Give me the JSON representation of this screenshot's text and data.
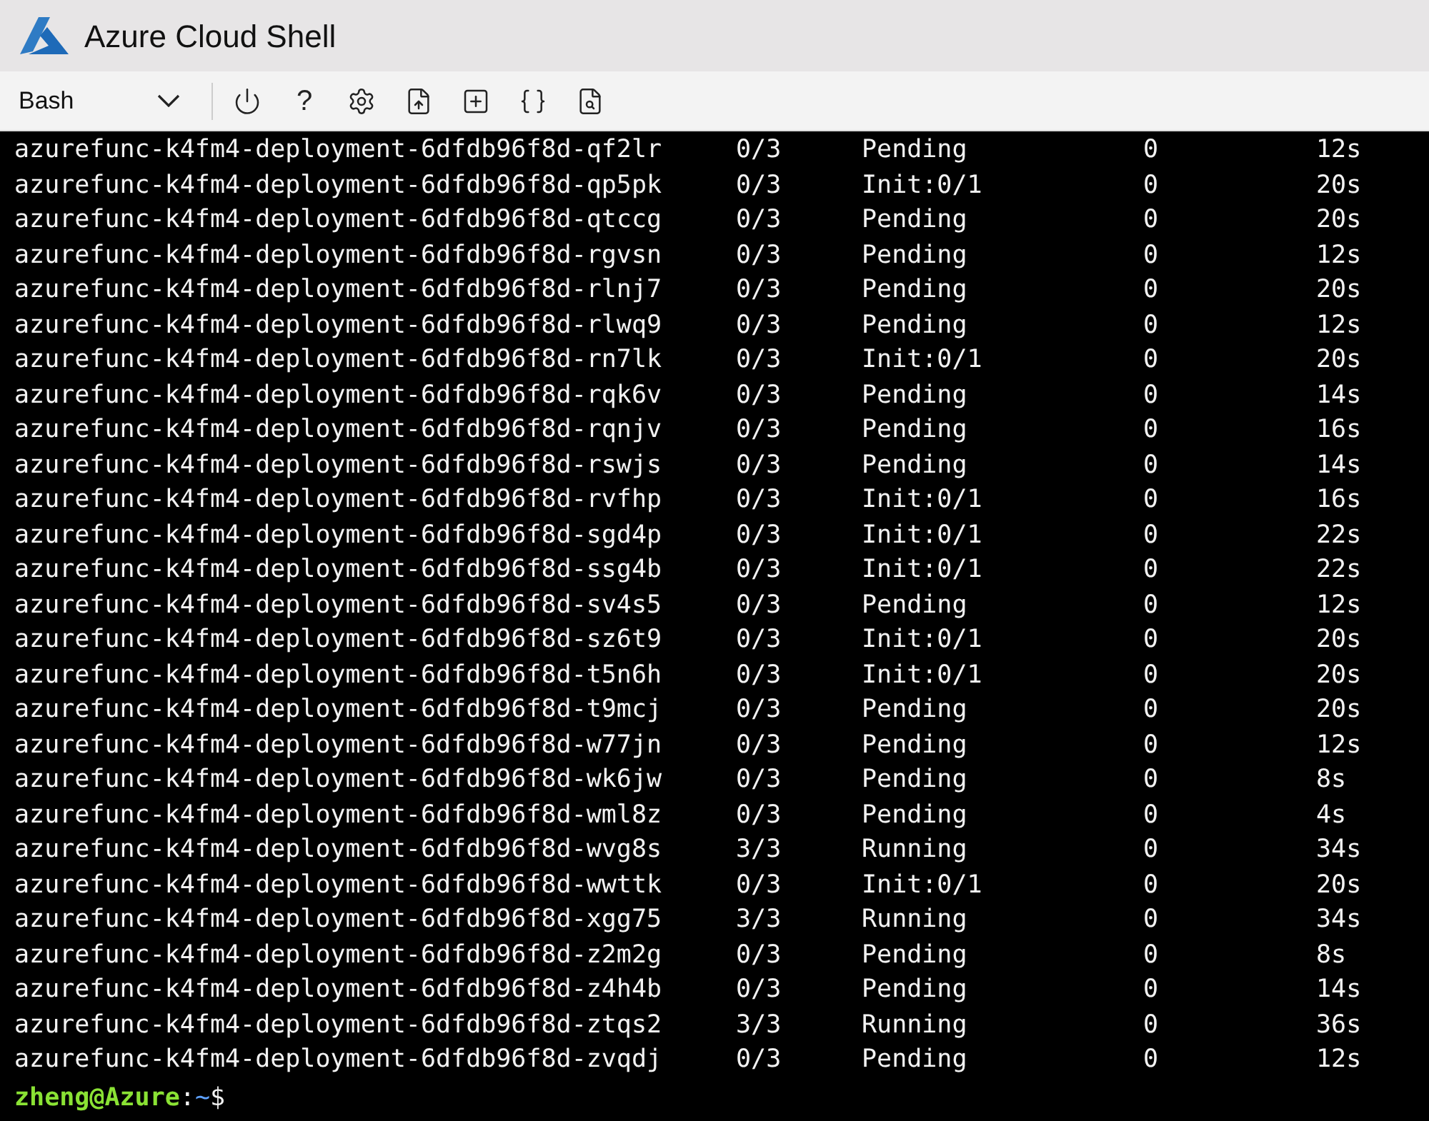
{
  "window": {
    "title": "Azure Cloud Shell"
  },
  "toolbar": {
    "shell": "Bash",
    "help": "?"
  },
  "terminal": {
    "rows": [
      {
        "name": "azurefunc-k4fm4-deployment-6dfdb96f8d-qf2lr",
        "ready": "0/3",
        "status": "Pending",
        "restarts": "0",
        "age": "12s"
      },
      {
        "name": "azurefunc-k4fm4-deployment-6dfdb96f8d-qp5pk",
        "ready": "0/3",
        "status": "Init:0/1",
        "restarts": "0",
        "age": "20s"
      },
      {
        "name": "azurefunc-k4fm4-deployment-6dfdb96f8d-qtccg",
        "ready": "0/3",
        "status": "Pending",
        "restarts": "0",
        "age": "20s"
      },
      {
        "name": "azurefunc-k4fm4-deployment-6dfdb96f8d-rgvsn",
        "ready": "0/3",
        "status": "Pending",
        "restarts": "0",
        "age": "12s"
      },
      {
        "name": "azurefunc-k4fm4-deployment-6dfdb96f8d-rlnj7",
        "ready": "0/3",
        "status": "Pending",
        "restarts": "0",
        "age": "20s"
      },
      {
        "name": "azurefunc-k4fm4-deployment-6dfdb96f8d-rlwq9",
        "ready": "0/3",
        "status": "Pending",
        "restarts": "0",
        "age": "12s"
      },
      {
        "name": "azurefunc-k4fm4-deployment-6dfdb96f8d-rn7lk",
        "ready": "0/3",
        "status": "Init:0/1",
        "restarts": "0",
        "age": "20s"
      },
      {
        "name": "azurefunc-k4fm4-deployment-6dfdb96f8d-rqk6v",
        "ready": "0/3",
        "status": "Pending",
        "restarts": "0",
        "age": "14s"
      },
      {
        "name": "azurefunc-k4fm4-deployment-6dfdb96f8d-rqnjv",
        "ready": "0/3",
        "status": "Pending",
        "restarts": "0",
        "age": "16s"
      },
      {
        "name": "azurefunc-k4fm4-deployment-6dfdb96f8d-rswjs",
        "ready": "0/3",
        "status": "Pending",
        "restarts": "0",
        "age": "14s"
      },
      {
        "name": "azurefunc-k4fm4-deployment-6dfdb96f8d-rvfhp",
        "ready": "0/3",
        "status": "Init:0/1",
        "restarts": "0",
        "age": "16s"
      },
      {
        "name": "azurefunc-k4fm4-deployment-6dfdb96f8d-sgd4p",
        "ready": "0/3",
        "status": "Init:0/1",
        "restarts": "0",
        "age": "22s"
      },
      {
        "name": "azurefunc-k4fm4-deployment-6dfdb96f8d-ssg4b",
        "ready": "0/3",
        "status": "Init:0/1",
        "restarts": "0",
        "age": "22s"
      },
      {
        "name": "azurefunc-k4fm4-deployment-6dfdb96f8d-sv4s5",
        "ready": "0/3",
        "status": "Pending",
        "restarts": "0",
        "age": "12s"
      },
      {
        "name": "azurefunc-k4fm4-deployment-6dfdb96f8d-sz6t9",
        "ready": "0/3",
        "status": "Init:0/1",
        "restarts": "0",
        "age": "20s"
      },
      {
        "name": "azurefunc-k4fm4-deployment-6dfdb96f8d-t5n6h",
        "ready": "0/3",
        "status": "Init:0/1",
        "restarts": "0",
        "age": "20s"
      },
      {
        "name": "azurefunc-k4fm4-deployment-6dfdb96f8d-t9mcj",
        "ready": "0/3",
        "status": "Pending",
        "restarts": "0",
        "age": "20s"
      },
      {
        "name": "azurefunc-k4fm4-deployment-6dfdb96f8d-w77jn",
        "ready": "0/3",
        "status": "Pending",
        "restarts": "0",
        "age": "12s"
      },
      {
        "name": "azurefunc-k4fm4-deployment-6dfdb96f8d-wk6jw",
        "ready": "0/3",
        "status": "Pending",
        "restarts": "0",
        "age": "8s"
      },
      {
        "name": "azurefunc-k4fm4-deployment-6dfdb96f8d-wml8z",
        "ready": "0/3",
        "status": "Pending",
        "restarts": "0",
        "age": "4s"
      },
      {
        "name": "azurefunc-k4fm4-deployment-6dfdb96f8d-wvg8s",
        "ready": "3/3",
        "status": "Running",
        "restarts": "0",
        "age": "34s"
      },
      {
        "name": "azurefunc-k4fm4-deployment-6dfdb96f8d-wwttk",
        "ready": "0/3",
        "status": "Init:0/1",
        "restarts": "0",
        "age": "20s"
      },
      {
        "name": "azurefunc-k4fm4-deployment-6dfdb96f8d-xgg75",
        "ready": "3/3",
        "status": "Running",
        "restarts": "0",
        "age": "34s"
      },
      {
        "name": "azurefunc-k4fm4-deployment-6dfdb96f8d-z2m2g",
        "ready": "0/3",
        "status": "Pending",
        "restarts": "0",
        "age": "8s"
      },
      {
        "name": "azurefunc-k4fm4-deployment-6dfdb96f8d-z4h4b",
        "ready": "0/3",
        "status": "Pending",
        "restarts": "0",
        "age": "14s"
      },
      {
        "name": "azurefunc-k4fm4-deployment-6dfdb96f8d-ztqs2",
        "ready": "3/3",
        "status": "Running",
        "restarts": "0",
        "age": "36s"
      },
      {
        "name": "azurefunc-k4fm4-deployment-6dfdb96f8d-zvqdj",
        "ready": "0/3",
        "status": "Pending",
        "restarts": "0",
        "age": "12s"
      }
    ],
    "prompt": {
      "user": "zheng@Azure",
      "separator": ":",
      "path": "~",
      "symbol": "$"
    }
  }
}
